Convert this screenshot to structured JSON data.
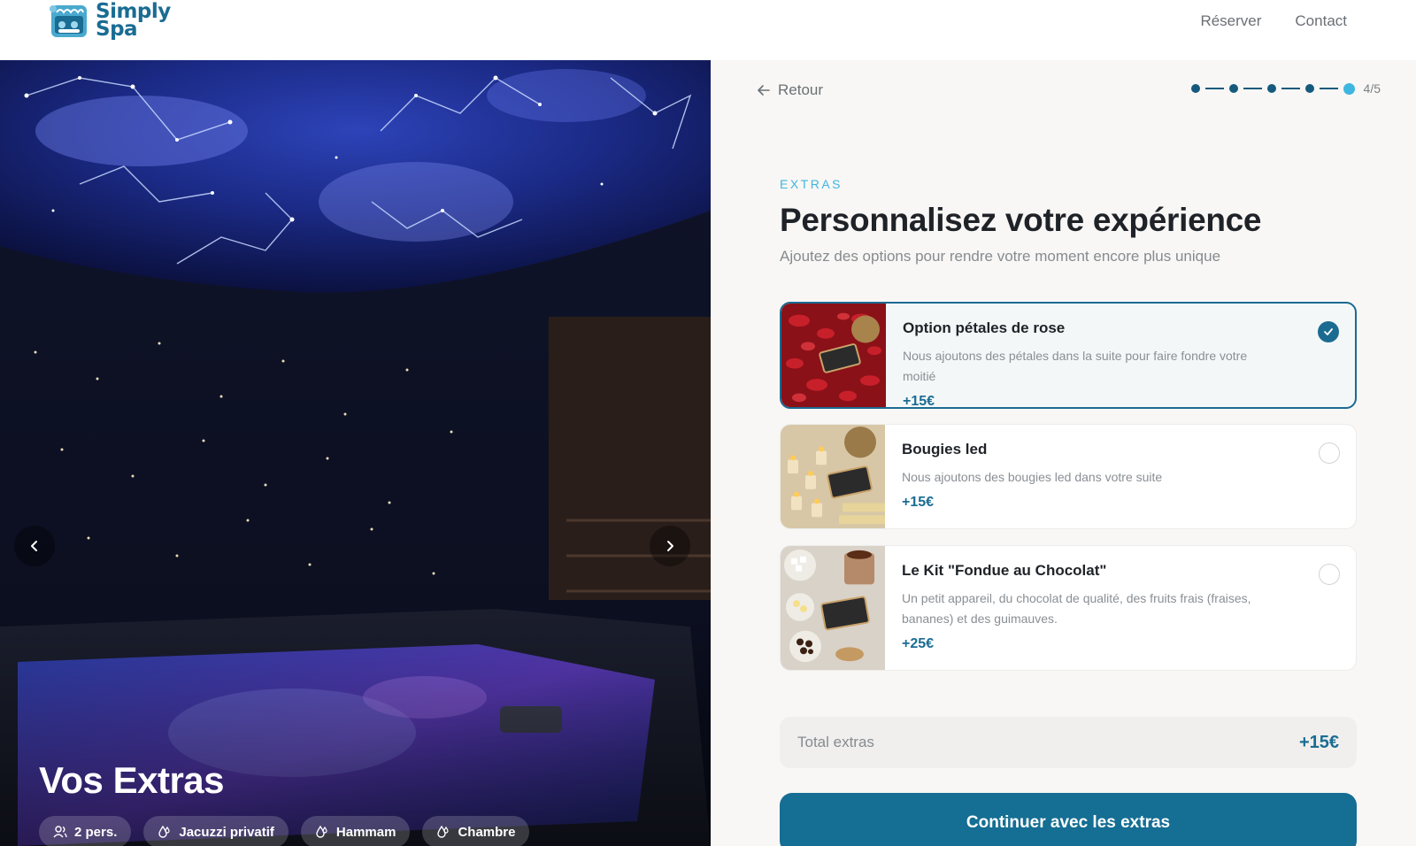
{
  "header": {
    "logo_line1": "Simply",
    "logo_line2": "Spa",
    "nav": [
      "Réserver",
      "Contact"
    ]
  },
  "hero": {
    "title": "Vos Extras",
    "chips": [
      {
        "icon": "users-icon",
        "label": "2 pers."
      },
      {
        "icon": "droplets-icon",
        "label": "Jacuzzi privatif"
      },
      {
        "icon": "droplets-icon",
        "label": "Hammam"
      },
      {
        "icon": "droplets-icon",
        "label": "Chambre"
      }
    ]
  },
  "panel": {
    "back_label": "Retour",
    "progress": {
      "current": 4,
      "total": 5,
      "label": "4/5"
    },
    "eyebrow": "EXTRAS",
    "title": "Personnalisez votre expérience",
    "subtitle": "Ajoutez des options pour rendre votre moment encore plus unique",
    "options": [
      {
        "name": "Option pétales de rose",
        "description": "Nous ajoutons des pétales dans la suite pour faire fondre votre moitié",
        "price": "+15€",
        "selected": true
      },
      {
        "name": "Bougies led",
        "description": "Nous ajoutons des bougies led dans votre suite",
        "price": "+15€",
        "selected": false
      },
      {
        "name": "Le Kit \"Fondue au Chocolat\"",
        "description": "Un petit appareil, du chocolat de qualité, des fruits frais (fraises, bananes) et des guimauves.",
        "price": "+25€",
        "selected": false
      }
    ],
    "total_label": "Total extras",
    "total_value": "+15€",
    "cta_label": "Continuer avec les extras"
  },
  "colors": {
    "brand": "#1a6c93",
    "accent": "#3fb6e0",
    "panel_bg": "#f8f7f5"
  }
}
